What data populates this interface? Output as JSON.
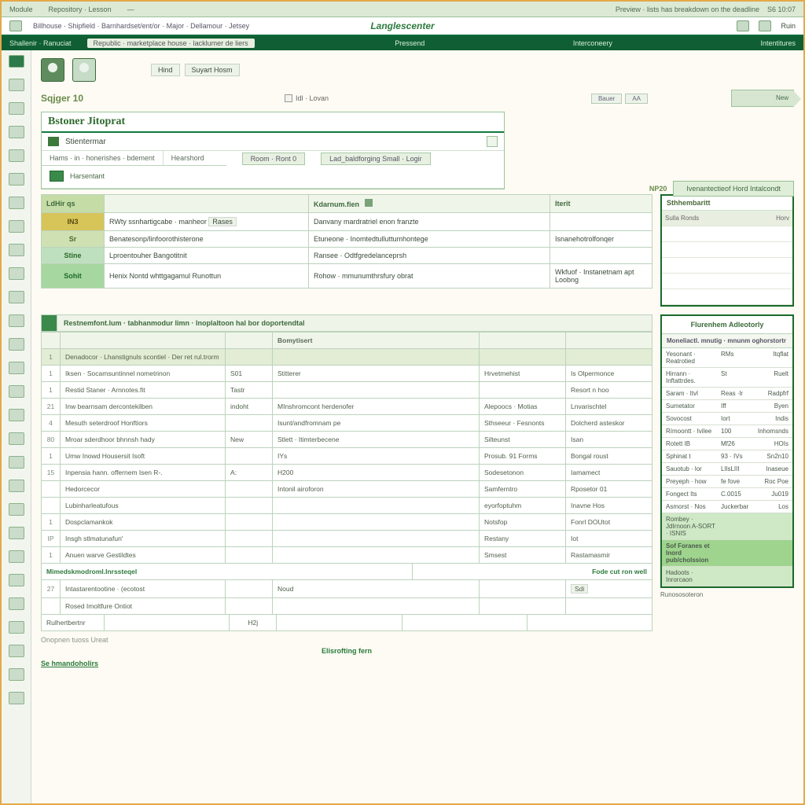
{
  "menu": {
    "items": [
      "Module",
      "Repository · Lesson",
      "—"
    ],
    "hint_right": "Preview · lists has breakdown on the deadline",
    "code": "S6 10:07"
  },
  "toolbar": {
    "crumb": "Billhouse · Shipfield · Barnhardset/ent/or · Major · Dellamour · Jetsey",
    "title": "Langlescenter",
    "rightItems": [
      "",
      "",
      "Ruin"
    ]
  },
  "strip3": {
    "left": "Shallenir · Ranuciat",
    "box": "Republic · marketplace house · lacklumer de liers",
    "mid1": "Pressend",
    "mid2": "Interconeery",
    "right": "Intentitures"
  },
  "patient": {
    "id_label": "Sqjger 10",
    "chips": [
      "Hind",
      "Suyart Hosm"
    ],
    "check": "Idl · Lovan",
    "mini_right": [
      "Bauer",
      "AA"
    ],
    "arrow": "New"
  },
  "card": {
    "title": "Bstoner Jitoprat",
    "sub": "Stientermar",
    "barA": "Hams · in · honerishes · bdement",
    "barB": "Hearshord",
    "barC": "Room · Ront 0",
    "barD": "Lad_baldforging Small · Logir",
    "subrow": "Harsentant",
    "freeR_code": "NP20",
    "freeR_pill": "Ivenantectieof Hord Intalcondt"
  },
  "table1": {
    "headers": [
      "LdHir qs",
      "",
      "Kdarnum.fien",
      "Iterit"
    ],
    "rows": [
      {
        "id": "IN3",
        "idClass": "id-y",
        "a": "RWty ssnhartigcabe · manheor",
        "aTag": "Rases",
        "b": "Danvany mardratriel enon franzte",
        "c": ""
      },
      {
        "id": "Sr",
        "idClass": "id-g1",
        "a": "Benatesonp/linfoorothisterone",
        "aTag": "",
        "b": "Etuneone · Inomtedtulluttumhontege",
        "c": "Isnanehotrolfonqer"
      },
      {
        "id": "Stine",
        "idClass": "id-g2",
        "a": "Lproentouher Bangotitnit",
        "aTag": "",
        "b": "Ransee · Odtfgredelanceprsh",
        "c": ""
      },
      {
        "id": "Sohit",
        "idClass": "id-g3",
        "a": "Henix Nontd whttgagamul Runottun",
        "aTag": "",
        "b": "Rohow · mmunumthrsfury obrat",
        "c": "Wkfuof · Instanetnam apt Loobng"
      }
    ]
  },
  "rpanel": {
    "title": "Sthhembaritt",
    "sub": "Sulla Ronds",
    "subR": "Horv"
  },
  "lower": {
    "header": "Restnemfont.lum · tabhanmodur limn · Inoplaltoon hal bor doportendtal",
    "subhead_cols": [
      "",
      "",
      "",
      "Bomytisert",
      "",
      ""
    ],
    "rows": [
      {
        "n": "1",
        "a": "Denadocor · Lhanstignuls scontiel · Der ret rul.trorm",
        "b": "",
        "c": "",
        "d": "",
        "e": ""
      },
      {
        "n": "1",
        "a": "Iksen · Socamsuntinnel nometrinon",
        "b": "S01",
        "c": "Stitterer",
        "d": "Hrvetmehist",
        "e": "Is Olpermonce"
      },
      {
        "n": "1",
        "a": "Restid Staner · Arnnotes.fit",
        "b": "Tastr",
        "c": "",
        "d": "",
        "e": "Resort n hoo"
      },
      {
        "n": "21",
        "a": "Inw bearnsam dercontekilben",
        "b": "indoht",
        "c": "MInshromcont herdenofer",
        "d": "Alepoocs · Motias",
        "e": "Lnvarischtel"
      },
      {
        "n": "4",
        "a": "Mesuth seterdroof Honftiors",
        "b": "",
        "c": "Isunt/andfromnam pe",
        "d": "Sthseeur · Fesnonts",
        "e": "Dolcherd asteskor"
      },
      {
        "n": "80",
        "a": "Mroar sderdhoor bhnnsh hady",
        "b": "New",
        "c": "Stlett · Itimterbecene",
        "d": "Silteunst",
        "e": "Isan"
      },
      {
        "n": "1",
        "a": "Umw Inowd Housersit Isoft",
        "b": "",
        "c": "IYs",
        "d": "Prosub. 91 Forms",
        "e": "Bongal roust"
      },
      {
        "n": "15",
        "a": "Inpensia hann. offernem Isen R-.",
        "b": "A:",
        "c": "H200",
        "d": "Sodesetonon",
        "e": "Iamamect"
      },
      {
        "n": "",
        "a": "Hedorcecor",
        "b": "",
        "c": "Intonil airoforon",
        "d": "Samferntro",
        "e": "Rposetor 01"
      },
      {
        "n": "",
        "a": "Lubinharleatufous",
        "b": "",
        "c": "",
        "d": "eyorfoptuhm",
        "e": "Inavne Hos"
      },
      {
        "n": "1",
        "a": "Dospclamankok",
        "b": "",
        "c": "",
        "d": "Notsfop",
        "e": "Fonrl DOUtot"
      },
      {
        "n": "IP",
        "a": "Insgh stlmatunafun'",
        "b": "",
        "c": "",
        "d": "Restany",
        "e": "Iot"
      },
      {
        "n": "1",
        "a": "Anuen warve Gestildtes",
        "b": "",
        "c": "",
        "d": "Smsest",
        "e": "Rastamasmir"
      }
    ],
    "green_row": {
      "a": "Mimedskmodroml.Inrssteqel",
      "e": "Fode cut ron well"
    },
    "tail_rows": [
      {
        "n": "27",
        "a": "Intastarentootine · (ecotost",
        "c": "Noud",
        "eTag": "Sdi"
      },
      {
        "n": "",
        "a": "Rosed Imoltfure Ontiot",
        "c": "",
        "e": ""
      }
    ],
    "footer_label": "Rulhertbertnr",
    "footer_val": "H2j",
    "bottom_line": "Onopnen tuoss Ureat",
    "center_link": "Elisrofting fern",
    "bl_link": "Se hmandoholirs"
  },
  "stats": {
    "title": "Flurenhem Adleotorly",
    "subtitle": "Moneliactl. mnutig · mnunm oghorstortr",
    "rows": [
      {
        "a": "Yesonant · Reatrotied",
        "b": "RMs",
        "c": "Itqflat"
      },
      {
        "a": "Hirrann · Inftattrdes.",
        "b": "St",
        "c": "Ruelt"
      },
      {
        "a": "Saram · Itvl",
        "b": "Reas ·lr",
        "c": "Radpfrf"
      },
      {
        "a": "Sumetator",
        "b": "Iff",
        "c": "Byen"
      },
      {
        "a": "Sovocost",
        "b": "Iort",
        "c": "Indis"
      },
      {
        "a": "Rímoontt · Ivilee",
        "b": "100",
        "c": "Inhomsnds"
      },
      {
        "a": "Rotett IB",
        "b": "Mf26",
        "c": "HOIs"
      },
      {
        "a": "Sphinat t",
        "b": "93 · IVs",
        "c": "Sn2n10"
      },
      {
        "a": "Sauotub · lor",
        "b": "LlIsLIII",
        "c": "Inaseue"
      },
      {
        "a": "Preyeph · how",
        "b": "fe fove",
        "c": "Roc Poe"
      },
      {
        "a": "Fongect Its",
        "b": "C.0015",
        "c": "Ju019"
      },
      {
        "a": "Asmorst · Nos",
        "b": "Juckerbar",
        "c": "Los"
      }
    ],
    "green1": "Rombey · JdIrnoon A-SORT · ISNIS",
    "green2a": "Sof Foranes et Inord pub/cholssion",
    "green2b": "Hadoots · Inrorcaon",
    "footnote": "Runososoteron"
  }
}
